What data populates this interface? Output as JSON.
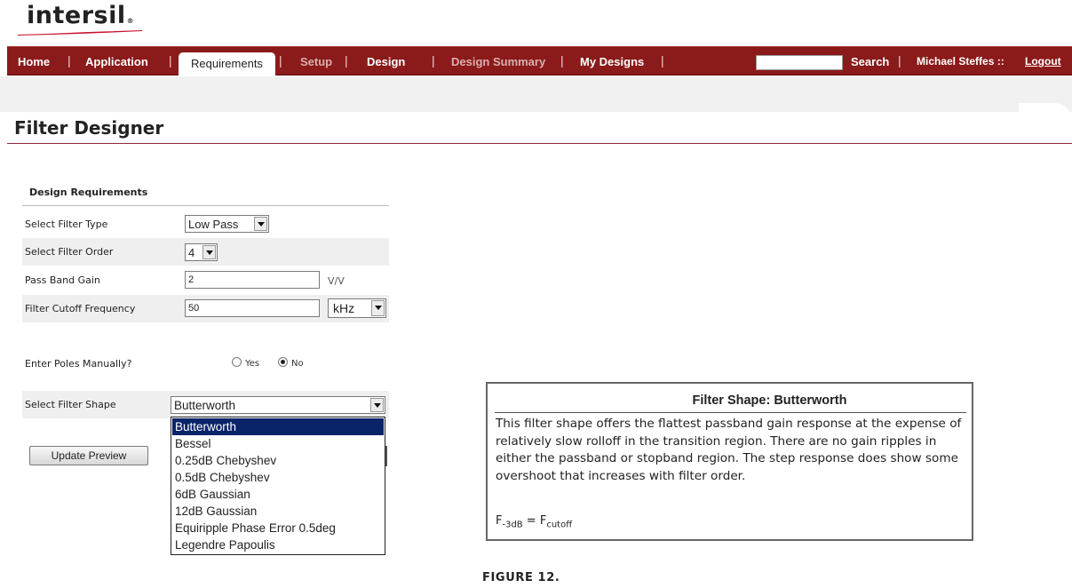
{
  "brand": {
    "logo_text": "intersil",
    "logo_mark": "®",
    "brand_color": "#8b1a1a"
  },
  "nav": {
    "home": "Home",
    "application": "Application",
    "requirements": "Requirements",
    "setup": "Setup",
    "design": "Design",
    "design_summary": "Design Summary",
    "my_designs": "My Designs",
    "search": "Search",
    "user": "Michael Steffes ::",
    "logout": "Logout",
    "separator": "|",
    "search_value": ""
  },
  "page": {
    "title": "Filter Designer"
  },
  "requirements": {
    "heading": "Design Requirements",
    "filter_type": {
      "label": "Select Filter Type",
      "value": "Low Pass"
    },
    "filter_order": {
      "label": "Select Filter Order",
      "value": "4"
    },
    "pass_band_gain": {
      "label": "Pass Band Gain",
      "value": "2",
      "unit": "V/V"
    },
    "cutoff": {
      "label": "Filter Cutoff Frequency",
      "value": "50",
      "unit": "kHz"
    },
    "poles": {
      "label": "Enter Poles Manually?",
      "yes": "Yes",
      "no": "No",
      "selected": "No"
    },
    "shape": {
      "label": "Select Filter Shape",
      "value": "Butterworth",
      "options": [
        "Butterworth",
        "Bessel",
        "0.25dB Chebyshev",
        "0.5dB Chebyshev",
        "6dB Gaussian",
        "12dB Gaussian",
        "Equiripple Phase Error 0.5deg",
        "Legendre Papoulis"
      ]
    },
    "update_button": "Update Preview"
  },
  "info": {
    "title": "Filter Shape: Butterworth",
    "body": "This filter shape offers the flattest passband gain response at the expense of relatively slow rolloff in the transition region. There are no gain ripples in either the passband or stopband region. The step response does show some overshoot that increases with filter order.",
    "formula_lhs": "F",
    "formula_lhs_sub": "-3dB",
    "formula_eq": " = ",
    "formula_rhs": "F",
    "formula_rhs_sub": "cutoff"
  },
  "caption": "FIGURE 12."
}
